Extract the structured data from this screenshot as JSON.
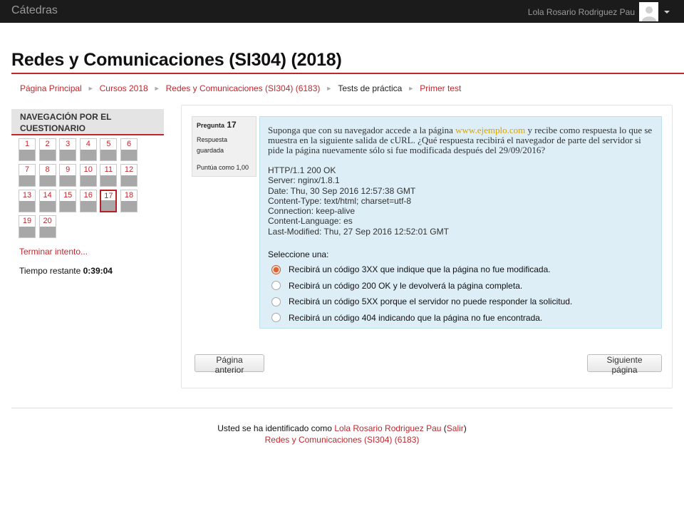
{
  "topbar": {
    "brand": "Cátedras",
    "user_name": "Lola Rosario Rodriguez Pau"
  },
  "page": {
    "heading": "Redes y Comunicaciones (SI304) (2018)"
  },
  "breadcrumb": [
    {
      "label": "Página Principal",
      "link": true
    },
    {
      "label": "Cursos 2018",
      "link": true
    },
    {
      "label": "Redes y Comunicaciones (SI304) (6183)",
      "link": true
    },
    {
      "label": "Tests de práctica",
      "link": false
    },
    {
      "label": "Primer test",
      "link": true
    }
  ],
  "quiz_nav": {
    "title": "NAVEGACIÓN POR EL CUESTIONARIO",
    "questions": [
      "1",
      "2",
      "3",
      "4",
      "5",
      "6",
      "7",
      "8",
      "9",
      "10",
      "11",
      "12",
      "13",
      "14",
      "15",
      "16",
      "17",
      "18",
      "19",
      "20"
    ],
    "current": "17",
    "finish_label": "Terminar intento...",
    "time_label": "Tiempo restante",
    "time_value": "0:39:04"
  },
  "question": {
    "label": "Pregunta",
    "number": "17",
    "state": "Respuesta guardada",
    "grade": "Puntúa como 1,00",
    "text_before": "Suponga que con su navegador accede a la página ",
    "text_highlight": "www.ejemplo.com",
    "text_after": " y recibe como respuesta lo que se muestra en la siguiente salida de cURL. ¿Qué respuesta recibirá el navegador de parte del servidor si pide la página nuevamente sólo si fue modificada después del 29/09/2016?",
    "curl_lines": [
      "HTTP/1.1 200 OK",
      "Server: nginx/1.8.1",
      "Date: Thu, 30 Sep 2016 12:57:38 GMT",
      "Content-Type: text/html; charset=utf-8",
      "Connection: keep-alive",
      "Content-Language: es",
      "Last-Modified: Thu, 27 Sep 2016 12:52:01 GMT"
    ],
    "prompt": "Seleccione una:",
    "answers": [
      "Recibirá un código 3XX que indique que la página no fue modificada.",
      "Recibirá un código 200 OK y le devolverá la página completa.",
      "Recibirá un código 5XX porque el servidor no puede responder la solicitud.",
      "Recibirá un código 404 indicando que la página no fue encontrada."
    ],
    "selected_index": 0
  },
  "buttons": {
    "prev": "Página anterior",
    "next": "Siguiente página"
  },
  "footer": {
    "logged_in_text": "Usted se ha identificado como",
    "user_name": "Lola Rosario Rodriguez Pau",
    "logout": "Salir",
    "course_link": "Redes y Comunicaciones (SI304) (6183)"
  },
  "colors": {
    "accent": "#c0272d",
    "topbar": "#1b1b1b",
    "question_bg": "#ddeef6",
    "highlight": "#d9a400"
  }
}
